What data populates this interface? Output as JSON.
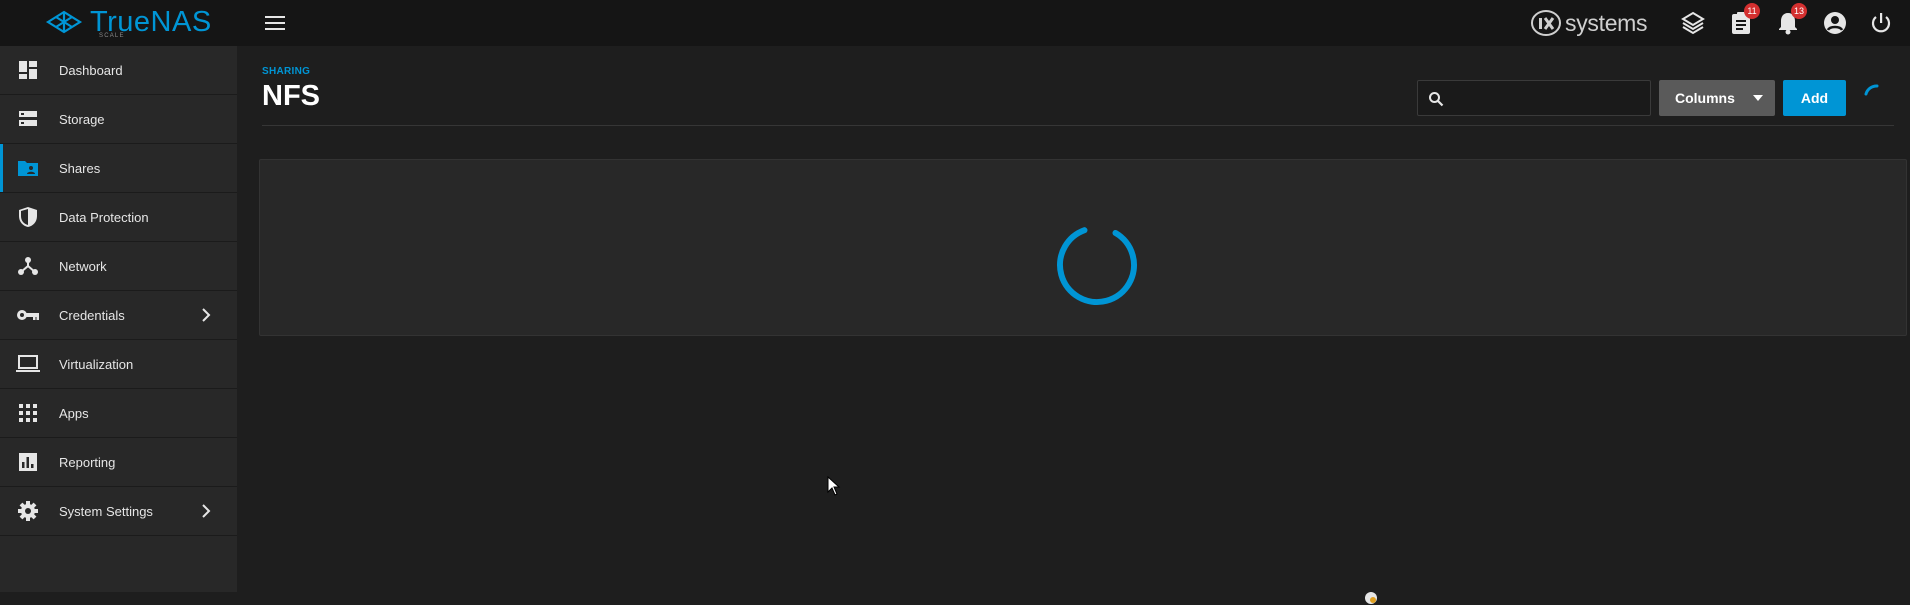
{
  "app": {
    "brand": "TrueNAS",
    "brand_sub": "SCALE",
    "vendor": "systems",
    "vendor_prefix": "iX"
  },
  "topbar": {
    "task_manager_badge": "11",
    "alerts_badge": "13"
  },
  "sidebar": {
    "items": [
      {
        "label": "Dashboard",
        "icon": "dashboard-icon"
      },
      {
        "label": "Storage",
        "icon": "storage-icon"
      },
      {
        "label": "Shares",
        "icon": "folder-shared-icon",
        "active": true
      },
      {
        "label": "Data Protection",
        "icon": "security-shield-icon"
      },
      {
        "label": "Network",
        "icon": "network-icon"
      },
      {
        "label": "Credentials",
        "icon": "key-icon",
        "has_children": true
      },
      {
        "label": "Virtualization",
        "icon": "laptop-icon"
      },
      {
        "label": "Apps",
        "icon": "apps-grid-icon"
      },
      {
        "label": "Reporting",
        "icon": "chart-icon"
      },
      {
        "label": "System Settings",
        "icon": "gear-icon",
        "has_children": true
      }
    ]
  },
  "main": {
    "breadcrumb": "SHARING",
    "title": "NFS",
    "search": {
      "value": "",
      "placeholder": ""
    },
    "columns_label": "Columns",
    "add_label": "Add"
  },
  "colors": {
    "accent": "#0095d5",
    "badge": "#d32f2f",
    "background": "#1e1e1e",
    "sidebar": "#282828",
    "topbar": "#151515"
  }
}
